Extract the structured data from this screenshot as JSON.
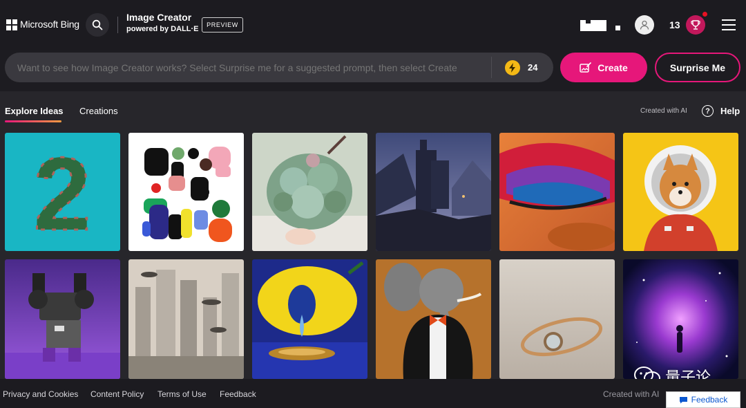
{
  "header": {
    "brand": "Microsoft Bing",
    "title": "Image Creator",
    "subtitle": "powered by DALL·E",
    "badge": "PREVIEW",
    "rewards_count": "13"
  },
  "prompt": {
    "placeholder": "Want to see how Image Creator works? Select Surprise me for a suggested prompt, then select Create",
    "boosts": "24",
    "create_label": "Create",
    "surprise_label": "Surprise Me"
  },
  "tabs": [
    "Explore Ideas",
    "Creations"
  ],
  "meta": {
    "created_with_ai": "Created with AI",
    "help": "Help"
  },
  "footer": {
    "links": [
      "Privacy and Cookies",
      "Content Policy",
      "Terms of Use",
      "Feedback"
    ],
    "created_with_ai": "Created with AI",
    "feedback_button": "Feedback"
  },
  "watermark": "量子论",
  "colors": {
    "accent": "#e6177a",
    "boost": "#f4b916",
    "background": "#1d1c21"
  }
}
